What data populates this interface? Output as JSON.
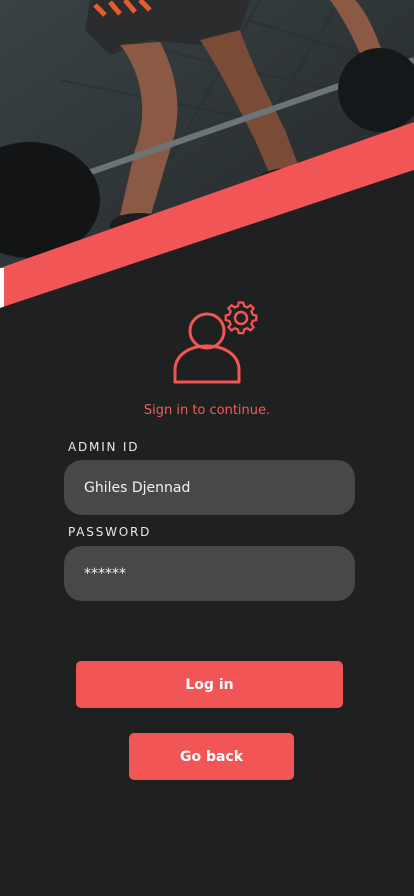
{
  "hero": {
    "image_description_icon": "weightlifter-photo"
  },
  "header_icon": "admin-user-gear-icon",
  "subtitle": "Sign in to continue.",
  "admin_id": {
    "label": "ADMIN ID",
    "value": "Ghiles Djennad"
  },
  "password": {
    "label": "PASSWORD",
    "value": "******"
  },
  "buttons": {
    "login": "Log in",
    "go_back": "Go back"
  },
  "colors": {
    "background": "#1f2020",
    "accent": "#f25555",
    "field": "#474848"
  }
}
